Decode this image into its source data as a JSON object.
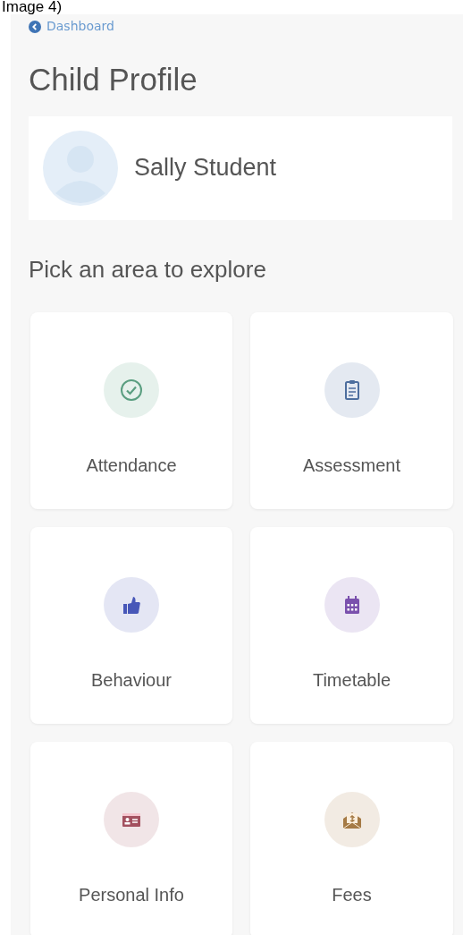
{
  "caption": "Image 4)",
  "back_link": {
    "label": "Dashboard"
  },
  "page_title": "Child Profile",
  "profile": {
    "name": "Sally Student"
  },
  "section_title": "Pick an area to explore",
  "areas": [
    {
      "label": "Attendance",
      "kind": "check",
      "color": "#5a9e80"
    },
    {
      "label": "Assessment",
      "kind": "clipboard",
      "color": "#4d6e9e"
    },
    {
      "label": "Behaviour",
      "kind": "thumb",
      "color": "#4757b8"
    },
    {
      "label": "Timetable",
      "kind": "calendar",
      "color": "#7a50ad"
    },
    {
      "label": "Personal Info",
      "kind": "card",
      "color": "#a3505f"
    },
    {
      "label": "Fees",
      "kind": "money",
      "color": "#a57a45"
    }
  ]
}
